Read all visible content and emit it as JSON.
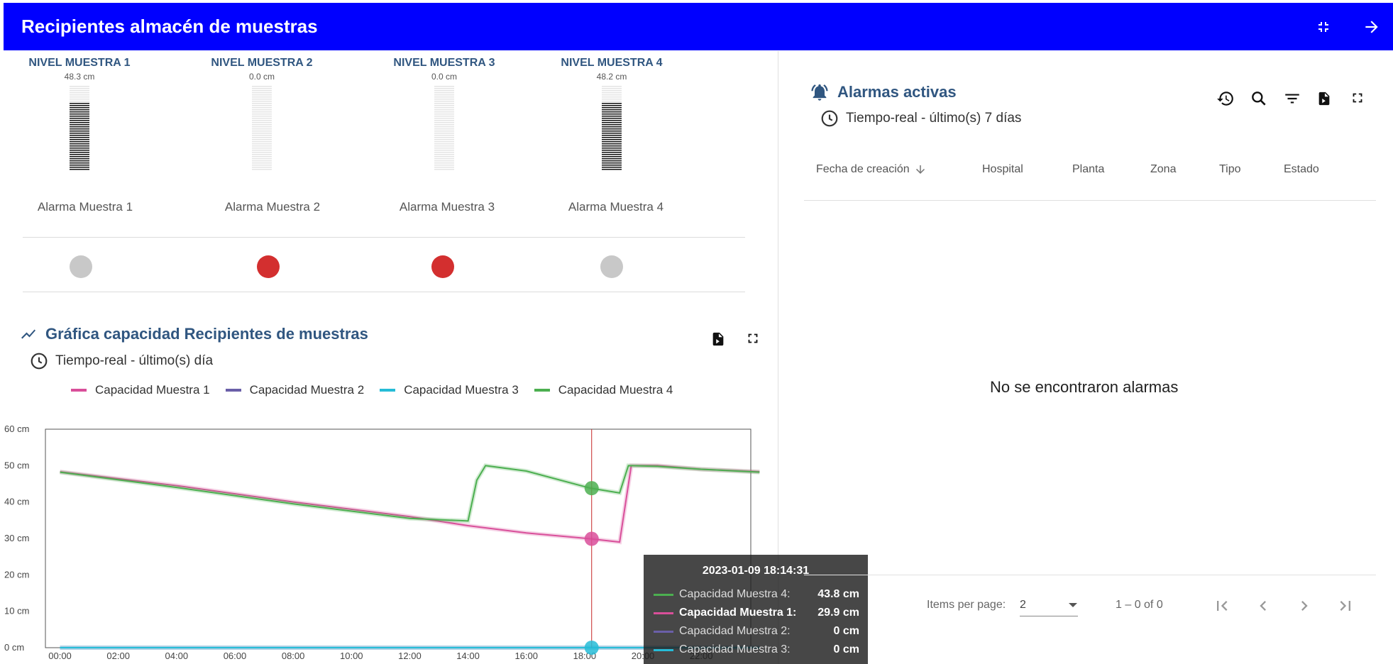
{
  "header": {
    "title": "Recipientes almacén de muestras",
    "collapse_icon": "fullscreen-exit-icon",
    "nav_icon": "arrow-forward-icon"
  },
  "gauges": [
    {
      "title": "NIVEL MUESTRA 1",
      "value": "48.3 cm",
      "level": 0.805
    },
    {
      "title": "NIVEL MUESTRA 2",
      "value": "0.0 cm",
      "level": 0
    },
    {
      "title": "NIVEL MUESTRA 3",
      "value": "0.0 cm",
      "level": 0
    },
    {
      "title": "NIVEL MUESTRA 4",
      "value": "48.2 cm",
      "level": 0.803
    }
  ],
  "alarms": [
    {
      "label": "Alarma Muestra 1",
      "active": false
    },
    {
      "label": "Alarma Muestra 2",
      "active": true
    },
    {
      "label": "Alarma Muestra 3",
      "active": true
    },
    {
      "label": "Alarma Muestra 4",
      "active": false
    }
  ],
  "chart_panel": {
    "title": "Gráfica capacidad Recipientes de muestras",
    "time": "Tiempo-real - último(s) día"
  },
  "colors": {
    "header": "#0000ff",
    "series1": "#d94f9a",
    "series2": "#6a5fa8",
    "series3": "#26bcd7",
    "series4": "#4caf50",
    "alarm_on": "#d32f2f",
    "alarm_off": "#c8c8c8"
  },
  "chart_data": {
    "type": "line",
    "series": [
      {
        "name": "Capacidad Muestra 1",
        "color": "#d94f9a",
        "points": [
          [
            0,
            48.3
          ],
          [
            4,
            44.5
          ],
          [
            8,
            40
          ],
          [
            12,
            36
          ],
          [
            14,
            33.5
          ],
          [
            16,
            31.5
          ],
          [
            18.2,
            29.9
          ],
          [
            19.2,
            29
          ],
          [
            19.6,
            50
          ],
          [
            20.5,
            50
          ],
          [
            22,
            49
          ],
          [
            24,
            48.3
          ]
        ]
      },
      {
        "name": "Capacidad Muestra 2",
        "color": "#6a5fa8",
        "points": [
          [
            0,
            0
          ],
          [
            24,
            0
          ]
        ]
      },
      {
        "name": "Capacidad Muestra 3",
        "color": "#26bcd7",
        "points": [
          [
            0,
            0
          ],
          [
            24,
            0
          ]
        ]
      },
      {
        "name": "Capacidad Muestra 4",
        "color": "#4caf50",
        "points": [
          [
            0,
            48.2
          ],
          [
            4,
            44
          ],
          [
            8,
            39.5
          ],
          [
            12,
            35.5
          ],
          [
            14,
            34.8
          ],
          [
            14.3,
            46
          ],
          [
            14.6,
            50
          ],
          [
            16,
            48.5
          ],
          [
            18.2,
            43.8
          ],
          [
            19.2,
            42.5
          ],
          [
            19.5,
            50
          ],
          [
            20.5,
            49.8
          ],
          [
            22,
            49
          ],
          [
            24,
            48.2
          ]
        ]
      }
    ],
    "xlabels": [
      "00:00",
      "02:00",
      "04:00",
      "06:00",
      "08:00",
      "10:00",
      "12:00",
      "14:00",
      "16:00",
      "18:00",
      "20:00",
      "22:00"
    ],
    "ylabels": [
      "0 cm",
      "10 cm",
      "20 cm",
      "30 cm",
      "40 cm",
      "50 cm",
      "60 cm"
    ],
    "ylim": [
      0,
      60
    ],
    "xlim": [
      -0.5,
      23.7
    ],
    "cursor_x": 18.24,
    "tooltip": {
      "time": "2023-01-09 18:14:31",
      "rows": [
        {
          "name": "Capacidad Muestra 4:",
          "value": "43.8 cm",
          "color": "#4caf50",
          "bold": false
        },
        {
          "name": "Capacidad Muestra 1:",
          "value": "29.9 cm",
          "color": "#d94f9a",
          "bold": true
        },
        {
          "name": "Capacidad Muestra 2:",
          "value": "0 cm",
          "color": "#6a5fa8",
          "bold": false
        },
        {
          "name": "Capacidad Muestra 3:",
          "value": "0 cm",
          "color": "#26bcd7",
          "bold": false
        }
      ]
    }
  },
  "alarms_panel": {
    "title": "Alarmas activas",
    "time": "Tiempo-real - último(s) 7 días",
    "columns": [
      "Fecha de creación",
      "Hospital",
      "Planta",
      "Zona",
      "Tipo",
      "Estado"
    ],
    "empty": "No se encontraron alarmas",
    "pager": {
      "items_label": "Items per page:",
      "items_value": "2",
      "range": "1 – 0 of 0"
    }
  }
}
